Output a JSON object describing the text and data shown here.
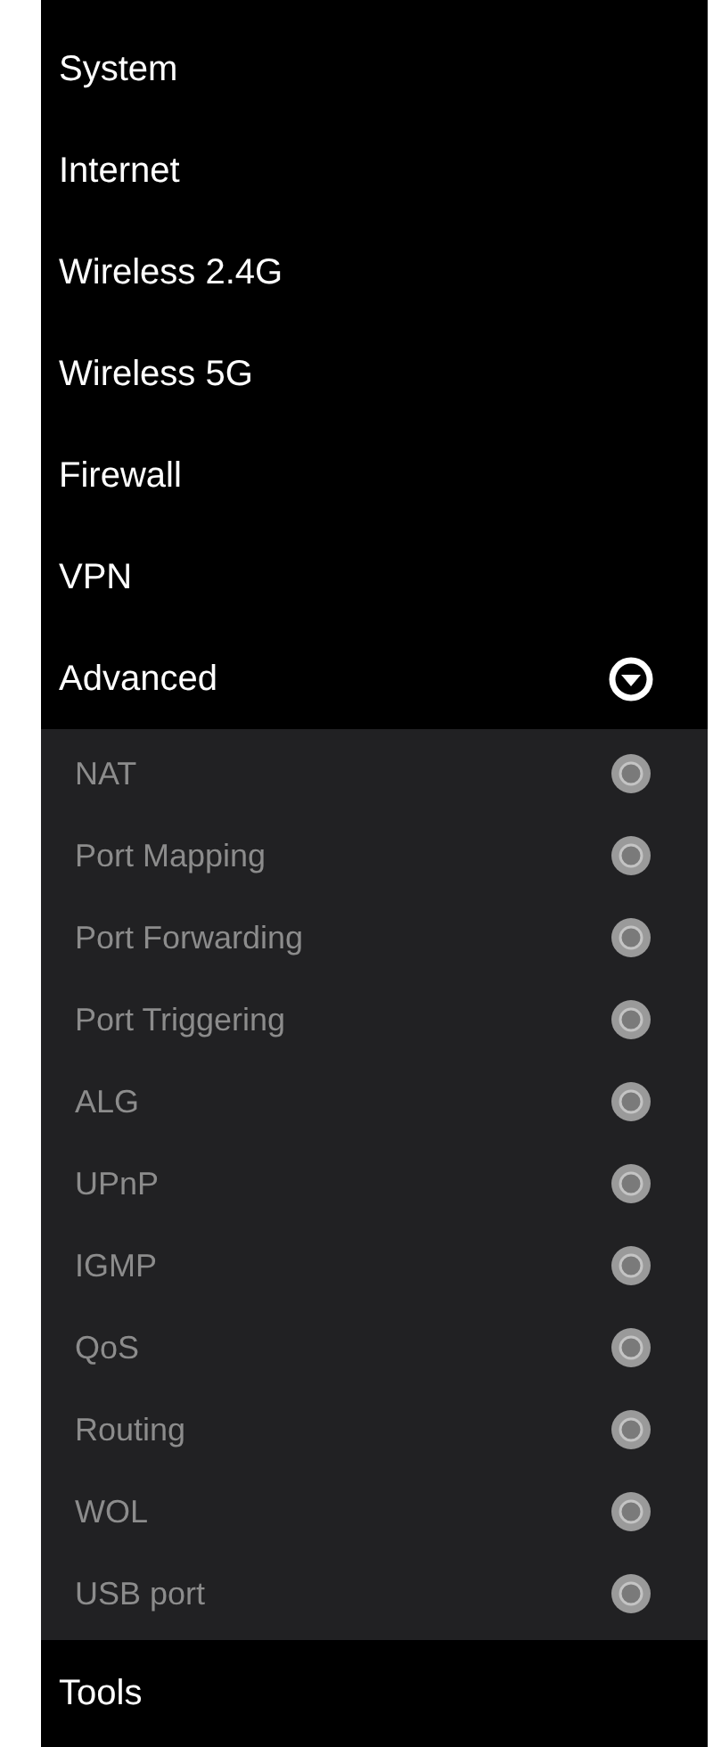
{
  "menu": [
    {
      "label": "System"
    },
    {
      "label": "Internet"
    },
    {
      "label": "Wireless 2.4G"
    },
    {
      "label": "Wireless 5G"
    },
    {
      "label": "Firewall"
    },
    {
      "label": "VPN"
    },
    {
      "label": "Advanced",
      "expanded": true,
      "children": [
        {
          "label": "NAT"
        },
        {
          "label": "Port Mapping"
        },
        {
          "label": "Port Forwarding"
        },
        {
          "label": "Port Triggering"
        },
        {
          "label": "ALG"
        },
        {
          "label": "UPnP"
        },
        {
          "label": "IGMP"
        },
        {
          "label": "QoS"
        },
        {
          "label": "Routing"
        },
        {
          "label": "WOL"
        },
        {
          "label": "USB port"
        }
      ]
    },
    {
      "label": "Tools"
    }
  ]
}
